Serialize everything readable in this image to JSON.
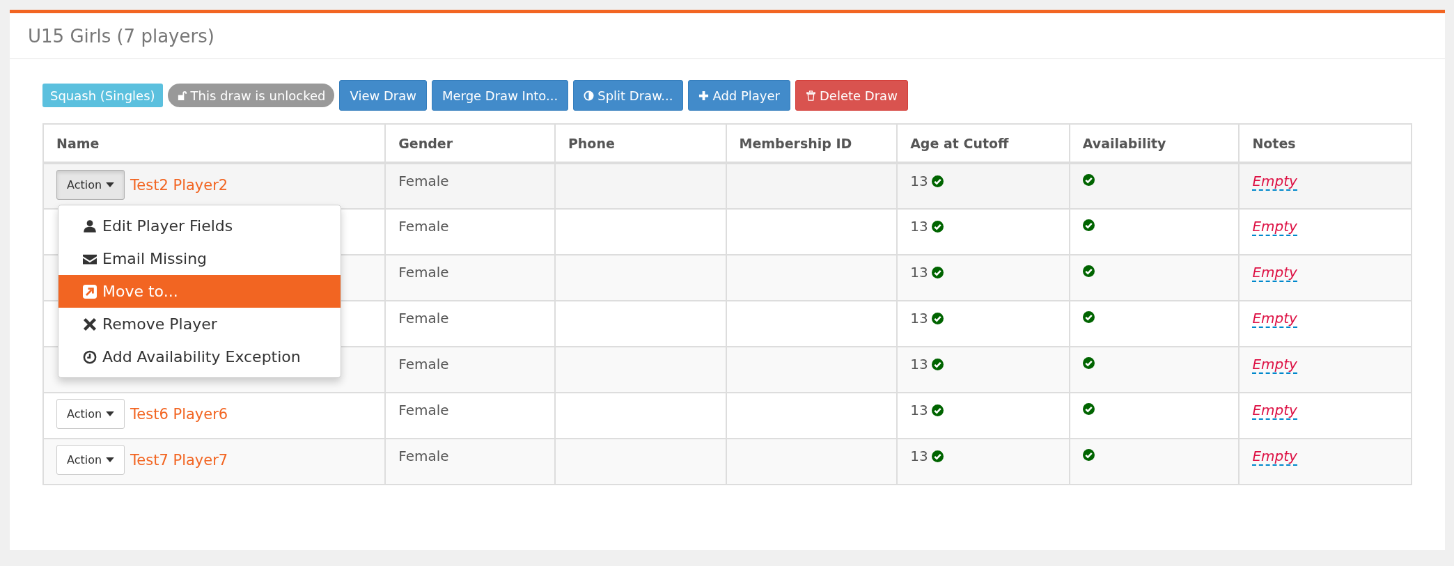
{
  "title": "U15 Girls (7 players)",
  "toolbar": [
    {
      "kind": "tag",
      "label": "Squash (Singles)"
    },
    {
      "kind": "lock",
      "label": "This draw is unlocked"
    },
    {
      "kind": "plain",
      "label": "View Draw"
    },
    {
      "kind": "plain",
      "label": "Merge Draw Into..."
    },
    {
      "kind": "split",
      "label": "Split Draw..."
    },
    {
      "kind": "add",
      "label": "Add Player"
    },
    {
      "kind": "delete",
      "label": "Delete Draw"
    }
  ],
  "table": {
    "columns": [
      "Name",
      "Gender",
      "Phone",
      "Membership ID",
      "Age at Cutoff",
      "Availability",
      "Notes"
    ],
    "rows": [
      {
        "action": "Action",
        "menu_open": true,
        "name": "Test2 Player2",
        "gender": "Female",
        "age": "13",
        "age_ok": true,
        "available": true,
        "notes": "Empty"
      },
      {
        "gender": "Female",
        "age": "13",
        "age_ok": true,
        "available": true,
        "notes": "Empty"
      },
      {
        "gender": "Female",
        "age": "13",
        "age_ok": true,
        "available": true,
        "notes": "Empty"
      },
      {
        "gender": "Female",
        "age": "13",
        "age_ok": true,
        "available": true,
        "notes": "Empty"
      },
      {
        "gender": "Female",
        "age": "13",
        "age_ok": true,
        "available": true,
        "notes": "Empty"
      },
      {
        "action": "Action",
        "menu_open": false,
        "name": "Test6 Player6",
        "gender": "Female",
        "age": "13",
        "age_ok": true,
        "available": true,
        "notes": "Empty"
      },
      {
        "action": "Action",
        "menu_open": false,
        "name": "Test7 Player7",
        "gender": "Female",
        "age": "13",
        "age_ok": true,
        "available": true,
        "notes": "Empty"
      }
    ]
  },
  "action_menu": [
    {
      "kind": "edit",
      "label": "Edit Player Fields",
      "selected": false
    },
    {
      "kind": "email",
      "label": "Email Missing",
      "selected": false
    },
    {
      "kind": "move",
      "label": "Move to...",
      "selected": true
    },
    {
      "kind": "remove",
      "label": "Remove Player",
      "selected": false
    },
    {
      "kind": "exception",
      "label": "Add Availability Exception",
      "selected": false
    }
  ]
}
